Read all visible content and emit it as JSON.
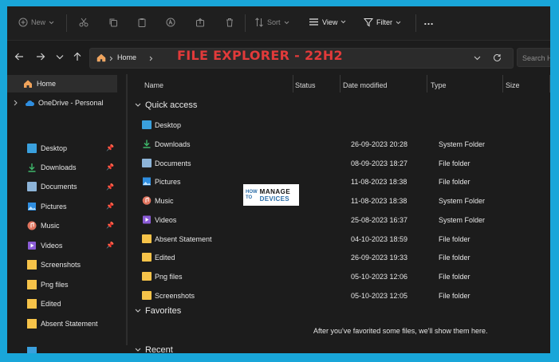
{
  "toolbar": {
    "new_label": "New",
    "sort_label": "Sort",
    "view_label": "View",
    "filter_label": "Filter",
    "more_label": "…"
  },
  "address": {
    "crumb": "Home",
    "search_placeholder": "Search Ho"
  },
  "overlay_title": "FILE EXPLORER - 22H2",
  "sidebar": {
    "items": [
      {
        "label": "Home",
        "icon": "home-icon"
      },
      {
        "label": "OneDrive - Personal",
        "icon": "cloud-icon"
      },
      {
        "label": "Desktop",
        "icon": "desktop-icon"
      },
      {
        "label": "Downloads",
        "icon": "download-icon"
      },
      {
        "label": "Documents",
        "icon": "documents-icon"
      },
      {
        "label": "Pictures",
        "icon": "pictures-icon"
      },
      {
        "label": "Music",
        "icon": "music-icon"
      },
      {
        "label": "Videos",
        "icon": "videos-icon"
      },
      {
        "label": "Screenshots",
        "icon": "folder-icon"
      },
      {
        "label": "Png files",
        "icon": "folder-icon"
      },
      {
        "label": "Edited",
        "icon": "folder-icon"
      },
      {
        "label": "Absent Statement",
        "icon": "folder-icon"
      }
    ]
  },
  "columns": {
    "name": "Name",
    "status": "Status",
    "date": "Date modified",
    "type": "Type",
    "size": "Size"
  },
  "groups": {
    "quick_access": "Quick access",
    "favorites": "Favorites",
    "recent": "Recent"
  },
  "files": [
    {
      "name": "Desktop",
      "date": "",
      "type": ""
    },
    {
      "name": "Downloads",
      "date": "26-09-2023 20:28",
      "type": "System Folder"
    },
    {
      "name": "Documents",
      "date": "08-09-2023 18:27",
      "type": "File folder"
    },
    {
      "name": "Pictures",
      "date": "11-08-2023 18:38",
      "type": "File folder"
    },
    {
      "name": "Music",
      "date": "11-08-2023 18:38",
      "type": "System Folder"
    },
    {
      "name": "Videos",
      "date": "25-08-2023 16:37",
      "type": "System Folder"
    },
    {
      "name": "Absent Statement",
      "date": "04-10-2023 18:59",
      "type": "File folder"
    },
    {
      "name": "Edited",
      "date": "26-09-2023 19:33",
      "type": "File folder"
    },
    {
      "name": "Png files",
      "date": "05-10-2023 12:06",
      "type": "File folder"
    },
    {
      "name": "Screenshots",
      "date": "05-10-2023 12:05",
      "type": "File folder"
    }
  ],
  "favorites_empty": "After you've favorited some files, we'll show them here.",
  "logo": {
    "line1": "HOW",
    "line2": "TO",
    "word1": "MANAGE",
    "word2": "DEVICES"
  },
  "colors": {
    "accent": "#19a6d9",
    "folder": "#f6c349",
    "title": "#e23a3a"
  }
}
